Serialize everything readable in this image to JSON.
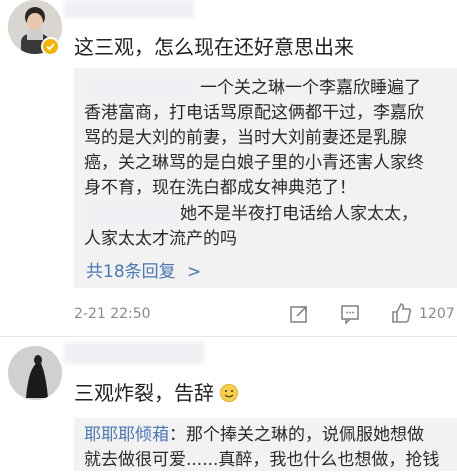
{
  "comment1": {
    "text": "这三观，怎么现在还好意思出来",
    "replies": {
      "r1_lines": [
        "一个关之琳一个李嘉欣睡遍了",
        "香港富商，打电话骂原配这俩都干过，李嘉欣",
        "骂的是大刘的前妻，当时大刘前妻还是乳腺",
        "癌，关之琳骂的是白娘子里的小青还害人家终",
        "身不育，现在洗白都成女神典范了！"
      ],
      "r2_lines": [
        "她不是半夜打电话给人家太太，",
        "人家太太才流产的吗"
      ],
      "more_label": "共18条回复",
      "more_arrow": ">"
    },
    "timestamp": "2-21 22:50",
    "like_count": "1207"
  },
  "comment2": {
    "text": "三观炸裂，告辞",
    "emoji": "smile-emoji",
    "reply": {
      "author": "耶耶耶倾葙",
      "line1": "：那个捧关之琳的，说佩服她想做",
      "line2": "就去做很可爱......真醉，我也什么也想做，抢钱"
    }
  }
}
